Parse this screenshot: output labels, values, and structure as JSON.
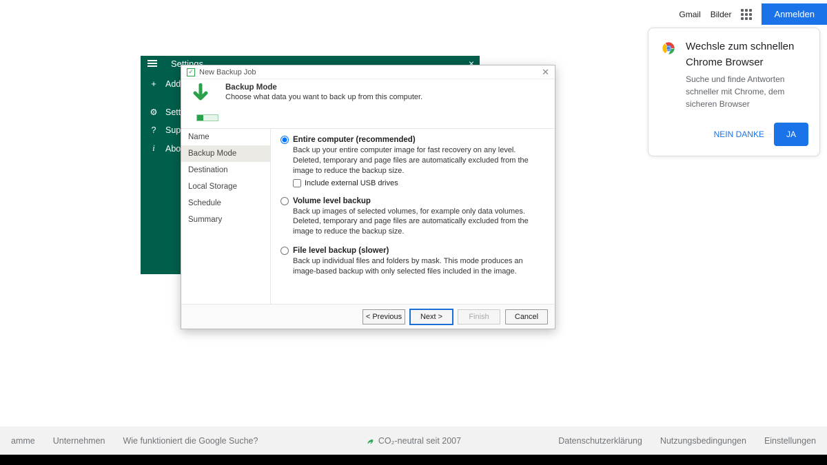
{
  "google": {
    "nav": {
      "gmail": "Gmail",
      "images": "Bilder",
      "signin": "Anmelden"
    },
    "promo": {
      "title": "Wechsle zum schnellen Chrome Browser",
      "body": "Suche und finde Antworten schneller mit Chrome, dem sicheren Browser",
      "no": "NEIN DANKE",
      "yes": "JA"
    },
    "footer": {
      "left": [
        "amme",
        "Unternehmen",
        "Wie funktioniert die Google Suche?"
      ],
      "center": "CO₂-neutral seit 2007",
      "right": [
        "Datenschutzerklärung",
        "Nutzungsbedingungen",
        "Einstellungen"
      ]
    }
  },
  "app": {
    "header": "Settings",
    "menu": [
      {
        "icon": "+",
        "label": "Add Ne"
      },
      {
        "icon": "⚙",
        "label": "Setting"
      },
      {
        "icon": "?",
        "label": "Suppor"
      },
      {
        "icon": "i",
        "label": "About"
      }
    ]
  },
  "wizard": {
    "window_title": "New Backup Job",
    "header_title": "Backup Mode",
    "header_sub": "Choose what data you want to back up from this computer.",
    "steps": [
      "Name",
      "Backup Mode",
      "Destination",
      "Local Storage",
      "Schedule",
      "Summary"
    ],
    "active_step_index": 1,
    "options": [
      {
        "title": "Entire computer (recommended)",
        "desc": "Back up your entire computer image for fast recovery on any level. Deleted, temporary and page files are automatically excluded from the image to reduce the backup size.",
        "selected": true,
        "checkbox_label": "Include external USB drives",
        "checkbox_checked": false
      },
      {
        "title": "Volume level backup",
        "desc": "Back up images of selected volumes, for example only data volumes. Deleted, temporary and page files are automatically excluded from the image to reduce the backup size.",
        "selected": false
      },
      {
        "title": "File level backup (slower)",
        "desc": "Back up individual files and folders by mask. This mode produces an image-based backup with only selected files included in the image.",
        "selected": false
      }
    ],
    "buttons": {
      "prev": "< Previous",
      "next": "Next >",
      "finish": "Finish",
      "cancel": "Cancel"
    }
  }
}
